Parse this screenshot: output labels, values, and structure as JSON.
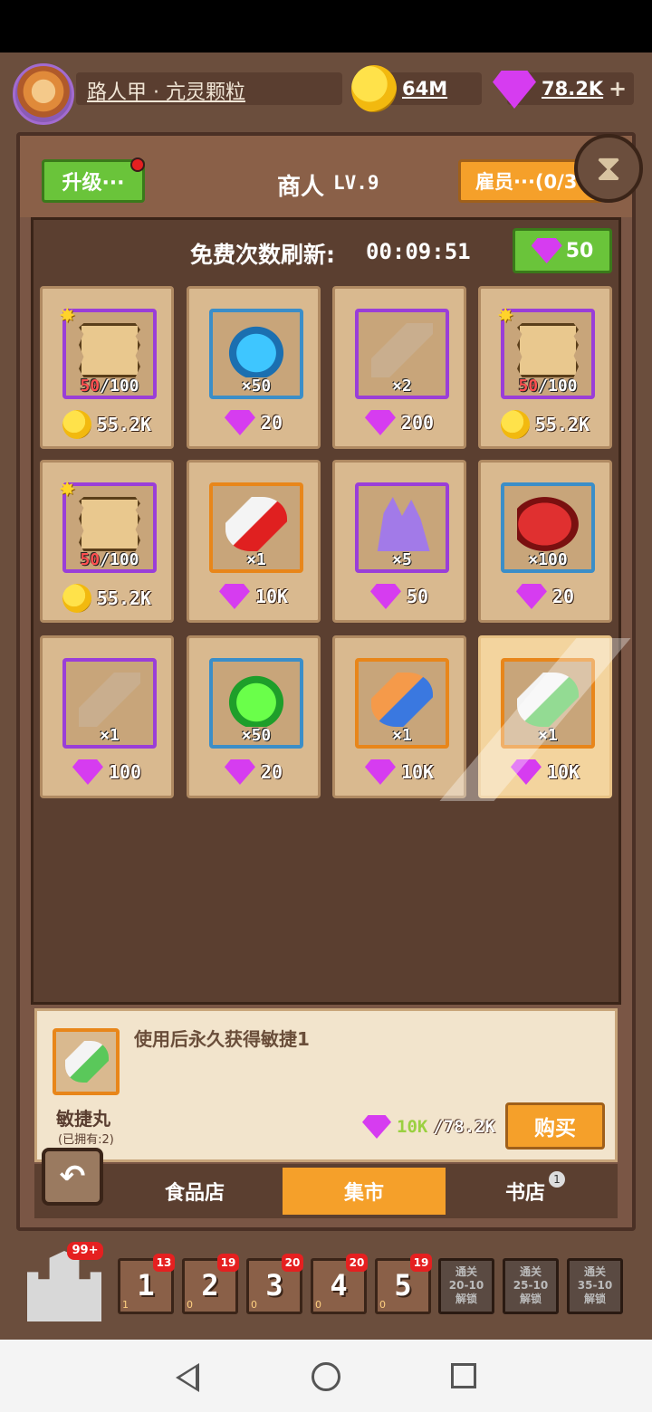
{
  "header": {
    "player_name": "路人甲 · 亢灵颗粒",
    "coins": "64M",
    "gems": "78.2K",
    "plus_label": "+"
  },
  "shop_header": {
    "upgrade_label": "升级···",
    "title": "商人",
    "level": "LV.9",
    "hire_label": "雇员···(0/3"
  },
  "refresh": {
    "label": "免费次数刷新:",
    "timer": "00:09:51",
    "cost": "50"
  },
  "items": [
    {
      "qty_owned": "50",
      "qty_total": "/100",
      "price": "55.2K",
      "currency": "coin",
      "art": "scroll",
      "slot": "purple",
      "star": true
    },
    {
      "qty": "×50",
      "price": "20",
      "currency": "gem",
      "art": "dust-blue",
      "slot": "blue"
    },
    {
      "qty": "×2",
      "price": "200",
      "currency": "gem",
      "art": "roll",
      "slot": "purple"
    },
    {
      "qty_owned": "50",
      "qty_total": "/100",
      "price": "55.2K",
      "currency": "coin",
      "art": "scroll",
      "slot": "purple",
      "star": true
    },
    {
      "qty_owned": "50",
      "qty_total": "/100",
      "price": "55.2K",
      "currency": "coin",
      "art": "scroll",
      "slot": "purple",
      "star": true
    },
    {
      "qty": "×1",
      "price": "10K",
      "currency": "gem",
      "art": "pill-red",
      "slot": "orange"
    },
    {
      "qty": "×5",
      "price": "50",
      "currency": "gem",
      "art": "crystal",
      "slot": "purple"
    },
    {
      "qty": "×100",
      "price": "20",
      "currency": "gem",
      "art": "meat",
      "slot": "blue"
    },
    {
      "qty": "×1",
      "price": "100",
      "currency": "gem",
      "art": "roll",
      "slot": "purple"
    },
    {
      "qty": "×50",
      "price": "20",
      "currency": "gem",
      "art": "dust-green",
      "slot": "blue"
    },
    {
      "qty": "×1",
      "price": "10K",
      "currency": "gem",
      "art": "pill-blue",
      "slot": "orange"
    },
    {
      "qty": "×1",
      "price": "10K",
      "currency": "gem",
      "art": "pill-green",
      "slot": "orange",
      "selected": true
    }
  ],
  "detail": {
    "description": "使用后永久获得敏捷1",
    "name": "敏捷丸",
    "owned": "(已拥有:2)",
    "price_have": "10K",
    "price_total": "/78.2K",
    "buy_label": "购买"
  },
  "tabs": {
    "food": "食品店",
    "market": "集市",
    "book": "书店",
    "book_badge": "1",
    "back_icon": "return-arrow-icon"
  },
  "bottom": {
    "castle_badge": "99+",
    "levels": [
      {
        "num": "1",
        "badge": "13",
        "sub": "1"
      },
      {
        "num": "2",
        "badge": "19",
        "sub": "0"
      },
      {
        "num": "3",
        "badge": "20",
        "sub": "0"
      },
      {
        "num": "4",
        "badge": "20",
        "sub": "0"
      },
      {
        "num": "5",
        "badge": "19",
        "sub": "0"
      }
    ],
    "locked": [
      {
        "line1": "通关",
        "line2": "20-10",
        "line3": "解锁"
      },
      {
        "line1": "通关",
        "line2": "25-10",
        "line3": "解锁"
      },
      {
        "line1": "通关",
        "line2": "35-10",
        "line3": "解锁"
      }
    ]
  }
}
